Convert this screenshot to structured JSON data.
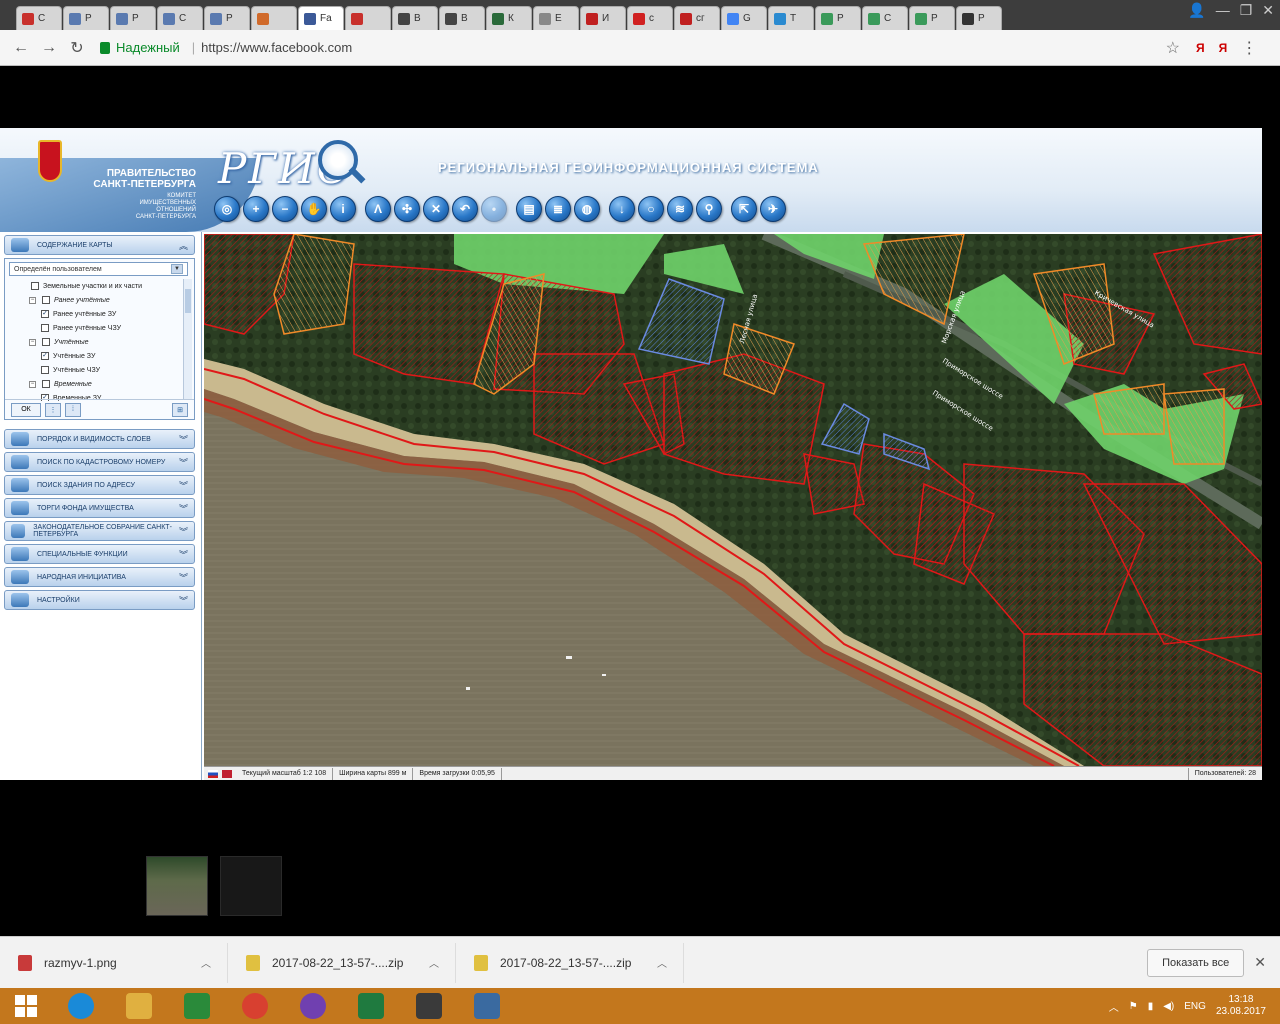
{
  "browser": {
    "tabs": [
      {
        "label": "С",
        "color": "#c8302c"
      },
      {
        "label": "Р",
        "color": "#5a7ab0"
      },
      {
        "label": "Р",
        "color": "#5a7ab0"
      },
      {
        "label": "С",
        "color": "#5a7ab0"
      },
      {
        "label": "Р",
        "color": "#5a7ab0"
      },
      {
        "label": "",
        "color": "#d06a2a"
      },
      {
        "label": "Fa",
        "color": "#3b5998"
      },
      {
        "label": "",
        "color": "#c8302c"
      },
      {
        "label": "В",
        "color": "#444444"
      },
      {
        "label": "В",
        "color": "#444444"
      },
      {
        "label": "К",
        "color": "#2a6a3a"
      },
      {
        "label": "Е",
        "color": "#888888"
      },
      {
        "label": "И",
        "color": "#c02020"
      },
      {
        "label": "с",
        "color": "#d02020"
      },
      {
        "label": "сг",
        "color": "#c02020"
      },
      {
        "label": "G",
        "color": "#4285f4"
      },
      {
        "label": "Т",
        "color": "#2a8ad0"
      },
      {
        "label": "Р",
        "color": "#3a9a5a"
      },
      {
        "label": "С",
        "color": "#3a9a5a"
      },
      {
        "label": "Р",
        "color": "#3a9a5a"
      },
      {
        "label": "Р",
        "color": "#333333"
      }
    ],
    "secure_label": "Надежный",
    "url": "https://www.facebook.com",
    "ext_icons": [
      "Я",
      "Я"
    ]
  },
  "app": {
    "gov_line1": "ПРАВИТЕЛЬСТВО",
    "gov_line2": "САНКТ-ПЕТЕРБУРГА",
    "committee_lines": [
      "КОМИТЕТ",
      "ИМУЩЕСТВЕННЫХ",
      "ОТНОШЕНИЙ",
      "САНКТ-ПЕТЕРБУРГА"
    ],
    "logo_text": "РГИС",
    "title": "РЕГИОНАЛЬНАЯ  ГЕОИНФОРМАЦИОННАЯ СИСТЕМА",
    "toolbar": [
      {
        "name": "globe",
        "glyph": "◎"
      },
      {
        "name": "zoom-in",
        "glyph": "+"
      },
      {
        "name": "zoom-out",
        "glyph": "−"
      },
      {
        "name": "pan",
        "glyph": "✋"
      },
      {
        "name": "info",
        "glyph": "i"
      },
      {
        "name": "measure",
        "glyph": "Λ"
      },
      {
        "name": "select",
        "glyph": "✣"
      },
      {
        "name": "clear",
        "glyph": "✕"
      },
      {
        "name": "back",
        "glyph": "↶"
      },
      {
        "name": "disabled",
        "glyph": "•"
      },
      {
        "name": "print",
        "glyph": "▤"
      },
      {
        "name": "list",
        "glyph": "≣"
      },
      {
        "name": "globe2",
        "glyph": "◍"
      },
      {
        "name": "download",
        "glyph": "↓"
      },
      {
        "name": "comment",
        "glyph": "○"
      },
      {
        "name": "rss",
        "glyph": "≋"
      },
      {
        "name": "pin",
        "glyph": "⚲"
      },
      {
        "name": "export",
        "glyph": "⇱"
      },
      {
        "name": "plane",
        "glyph": "✈"
      }
    ]
  },
  "sidebar": {
    "content_panel": "СОДЕРЖАНИЕ КАРТЫ",
    "user_select": "Определён пользователем",
    "tree": [
      {
        "label": "Земельные участки и их части",
        "indent": 1,
        "checked": false,
        "group": false
      },
      {
        "label": "Ранее учтённые",
        "indent": 2,
        "checked": false,
        "group": true
      },
      {
        "label": "Ранее учтённые ЗУ",
        "indent": 3,
        "checked": true,
        "group": false
      },
      {
        "label": "Ранее учтённые ЧЗУ",
        "indent": 3,
        "checked": false,
        "group": false
      },
      {
        "label": "Учтённые",
        "indent": 2,
        "checked": false,
        "group": true
      },
      {
        "label": "Учтённые ЗУ",
        "indent": 3,
        "checked": true,
        "group": false
      },
      {
        "label": "Учтённые ЧЗУ",
        "indent": 3,
        "checked": false,
        "group": false
      },
      {
        "label": "Временные",
        "indent": 2,
        "checked": false,
        "group": true
      },
      {
        "label": "Временные ЗУ",
        "indent": 3,
        "checked": true,
        "group": false
      }
    ],
    "ok_label": "ОК",
    "panels": [
      "ПОРЯДОК И ВИДИМОСТЬ СЛОЕВ",
      "ПОИСК ПО КАДАСТРОВОМУ НОМЕРУ",
      "ПОИСК ЗДАНИЯ ПО АДРЕСУ",
      "ТОРГИ ФОНДА ИМУЩЕСТВА",
      "ЗАКОНОДАТЕЛЬНОЕ СОБРАНИЕ САНКТ-ПЕТЕРБУРГА",
      "СПЕЦИАЛЬНЫЕ ФУНКЦИИ",
      "НАРОДНАЯ ИНИЦИАТИВА",
      "НАСТРОЙКИ"
    ]
  },
  "map": {
    "street_labels": [
      "Приморское шоссе",
      "Приморское шоссе",
      "Кричевская улица",
      "Морская улица",
      "Лесная улица"
    ]
  },
  "statusbar": {
    "scale": "Текущий масштаб 1:2 108",
    "width": "Ширина карты 899 м",
    "load_time": "Время загрузки 0:05,95",
    "user": "Пользователей: 28"
  },
  "downloads": [
    {
      "name": "razmyv-1.png",
      "type": "png"
    },
    {
      "name": "2017-08-22_13-57-....zip",
      "type": "zip"
    },
    {
      "name": "2017-08-22_13-57-....zip",
      "type": "zip"
    }
  ],
  "show_all_label": "Показать все",
  "taskbar": {
    "apps": [
      "ie",
      "explorer",
      "store",
      "chrome",
      "viber",
      "excel",
      "notepad",
      "photos"
    ],
    "lang": "ENG",
    "time": "13:18",
    "date": "23.08.2017"
  }
}
